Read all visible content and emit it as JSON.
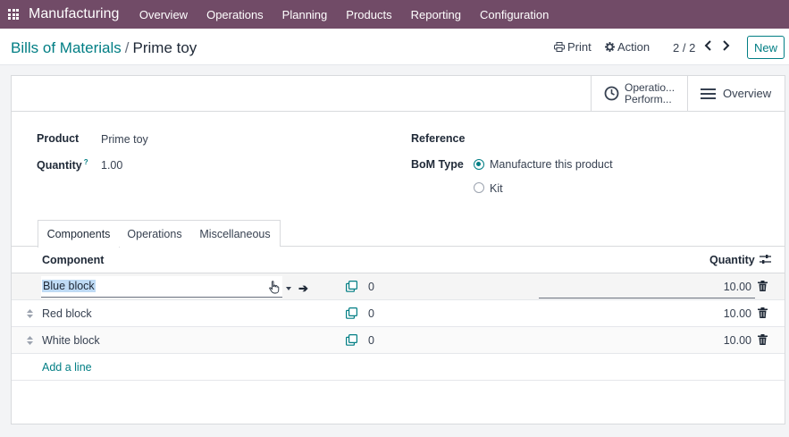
{
  "navbar": {
    "app_name": "Manufacturing",
    "menu": [
      "Overview",
      "Operations",
      "Planning",
      "Products",
      "Reporting",
      "Configuration"
    ]
  },
  "control_panel": {
    "breadcrumb_parent": "Bills of Materials",
    "breadcrumb_separator": "/",
    "breadcrumb_current": "Prime toy",
    "print_label": "Print",
    "action_label": "Action",
    "pager": "2 / 2",
    "new_label": "New"
  },
  "smart_buttons": {
    "operations_line1": "Operatio...",
    "operations_line2": "Perform...",
    "overview_label": "Overview"
  },
  "form": {
    "product_label": "Product",
    "product_value": "Prime toy",
    "quantity_label": "Quantity",
    "quantity_help": "?",
    "quantity_value": "1.00",
    "reference_label": "Reference",
    "bom_type_label": "BoM Type",
    "bom_type_options": [
      {
        "label": "Manufacture this product",
        "selected": true
      },
      {
        "label": "Kit",
        "selected": false
      }
    ]
  },
  "tabs": [
    "Components",
    "Operations",
    "Miscellaneous"
  ],
  "components_table": {
    "headers": {
      "component": "Component",
      "quantity": "Quantity"
    },
    "rows": [
      {
        "component": "Blue block",
        "consumed": "0",
        "quantity": "10.00"
      },
      {
        "component": "Red block",
        "consumed": "0",
        "quantity": "10.00"
      },
      {
        "component": "White block",
        "consumed": "0",
        "quantity": "10.00"
      }
    ],
    "add_line": "Add a line"
  },
  "colors": {
    "navbar": "#714b67",
    "accent": "#017e84"
  }
}
